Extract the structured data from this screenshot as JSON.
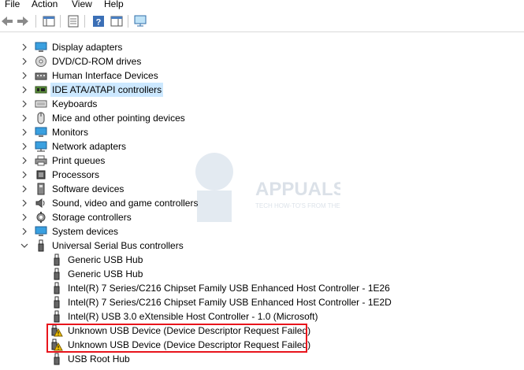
{
  "menu": [
    "File",
    "Action",
    "View",
    "Help"
  ],
  "toolbar": {
    "buttons": [
      "back-icon",
      "forward-icon",
      "show-hide-tree-icon",
      "properties-icon",
      "help-icon",
      "action-pane-icon",
      "scan-hardware-icon"
    ]
  },
  "tree": {
    "categories": [
      {
        "label": "Display adapters",
        "icon": "display-icon",
        "expanded": false
      },
      {
        "label": "DVD/CD-ROM drives",
        "icon": "dvd-drive-icon",
        "expanded": false
      },
      {
        "label": "Human Interface Devices",
        "icon": "hid-icon",
        "expanded": false
      },
      {
        "label": "IDE ATA/ATAPI controllers",
        "icon": "ide-controller-icon",
        "expanded": false,
        "selected": true
      },
      {
        "label": "Keyboards",
        "icon": "keyboard-icon",
        "expanded": false
      },
      {
        "label": "Mice and other pointing devices",
        "icon": "mouse-icon",
        "expanded": false
      },
      {
        "label": "Monitors",
        "icon": "monitor-icon",
        "expanded": false
      },
      {
        "label": "Network adapters",
        "icon": "network-icon",
        "expanded": false
      },
      {
        "label": "Print queues",
        "icon": "printer-icon",
        "expanded": false
      },
      {
        "label": "Processors",
        "icon": "processor-icon",
        "expanded": false
      },
      {
        "label": "Software devices",
        "icon": "software-device-icon",
        "expanded": false
      },
      {
        "label": "Sound, video and game controllers",
        "icon": "sound-icon",
        "expanded": false
      },
      {
        "label": "Storage controllers",
        "icon": "storage-icon",
        "expanded": false
      },
      {
        "label": "System devices",
        "icon": "system-device-icon",
        "expanded": false
      },
      {
        "label": "Universal Serial Bus controllers",
        "icon": "usb-icon",
        "expanded": true
      }
    ],
    "usb_children": [
      {
        "label": "Generic USB Hub",
        "warning": false
      },
      {
        "label": "Generic USB Hub",
        "warning": false
      },
      {
        "label": "Intel(R) 7 Series/C216 Chipset Family USB Enhanced Host Controller - 1E26",
        "warning": false
      },
      {
        "label": "Intel(R) 7 Series/C216 Chipset Family USB Enhanced Host Controller - 1E2D",
        "warning": false
      },
      {
        "label": "Intel(R) USB 3.0 eXtensible Host Controller - 1.0 (Microsoft)",
        "warning": false
      },
      {
        "label": "Unknown USB Device (Device Descriptor Request Failed)",
        "warning": true
      },
      {
        "label": "Unknown USB Device (Device Descriptor Request Failed)",
        "warning": true
      },
      {
        "label": "USB Root Hub",
        "warning": false
      }
    ]
  },
  "watermark": {
    "brand": "APPUALS",
    "tagline": "TECH HOW-TO'S FROM THE EXPERTS!"
  },
  "colors": {
    "selection": "#cce8ff",
    "highlight_border": "#e8141c",
    "warning": "#f2c200"
  }
}
